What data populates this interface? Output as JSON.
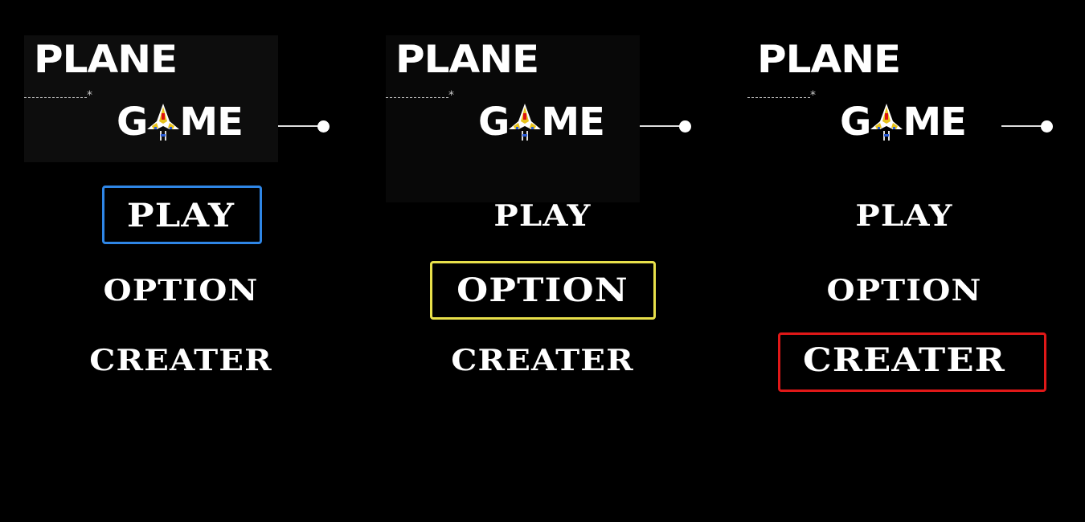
{
  "title": {
    "word1": "PLANE",
    "word2_before": "G",
    "word2_after": "ME",
    "ship_icon": "plane-ship-icon"
  },
  "decor": {
    "star": "*"
  },
  "screens": [
    {
      "menu": [
        "PLAY",
        "OPTION",
        "CREATER"
      ],
      "selected": "PLAY",
      "highlight_color": "#2f86e6"
    },
    {
      "menu": [
        "PLAY",
        "OPTION",
        "CREATER"
      ],
      "selected": "OPTION",
      "highlight_color": "#e8e04a"
    },
    {
      "menu": [
        "PLAY",
        "OPTION",
        "CREATER"
      ],
      "selected": "CREATER",
      "highlight_color": "#e01818"
    }
  ]
}
